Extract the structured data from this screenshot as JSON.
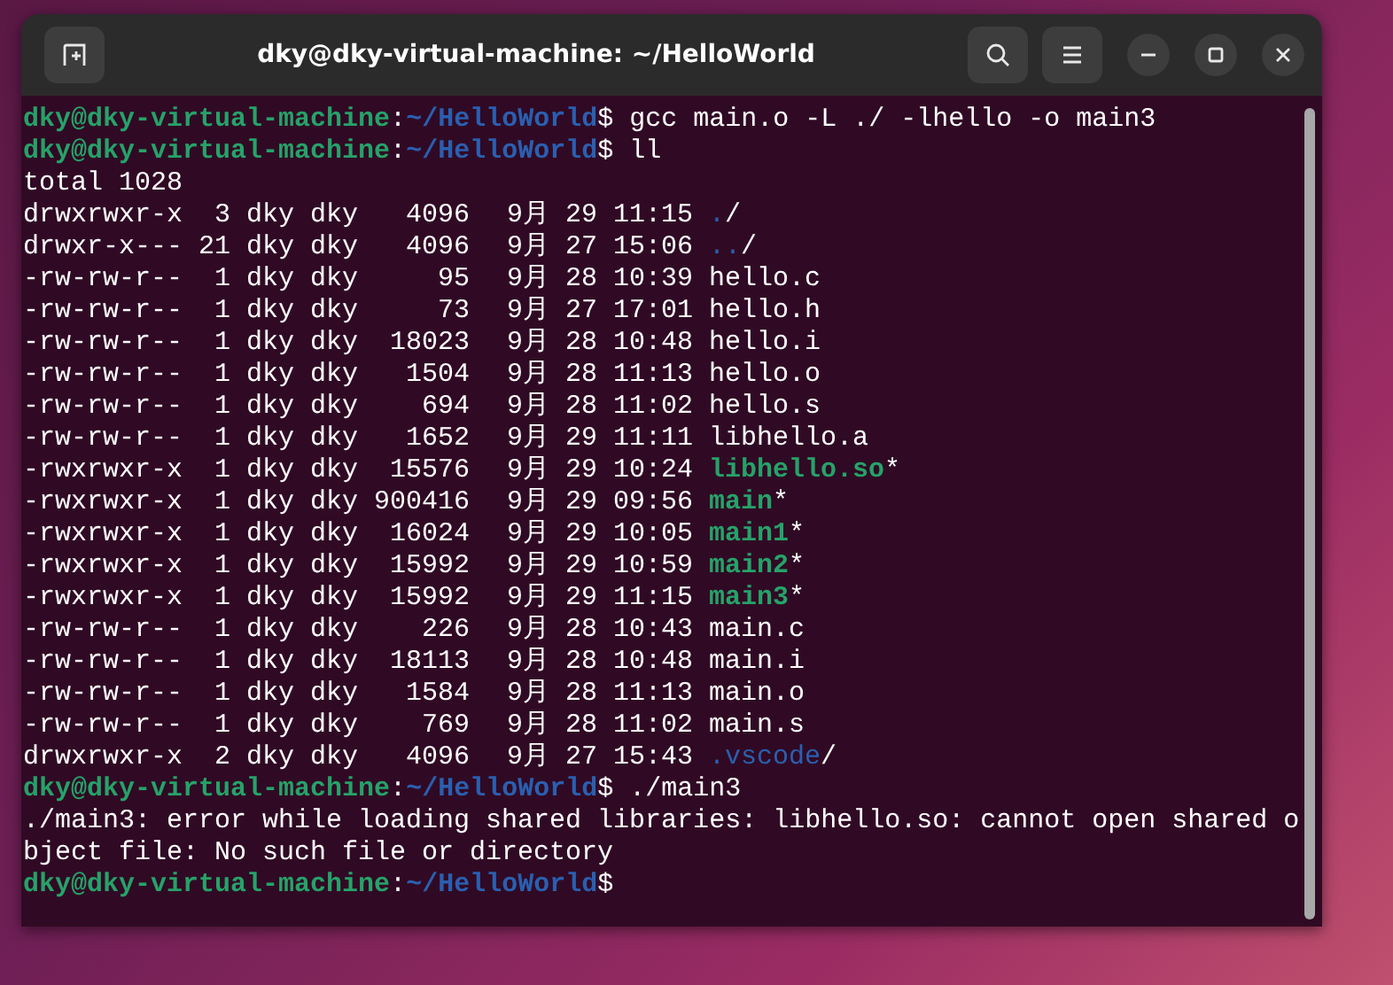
{
  "window": {
    "title": "dky@dky-virtual-machine: ~/HelloWorld"
  },
  "lines": [
    {
      "kind": "prompt",
      "user": "dky@dky-virtual-machine",
      "separator": ":",
      "path": "~/HelloWorld",
      "symbol": "$",
      "command": "gcc main.o -L ./ -lhello -o main3"
    },
    {
      "kind": "prompt",
      "user": "dky@dky-virtual-machine",
      "separator": ":",
      "path": "~/HelloWorld",
      "symbol": "$",
      "command": "ll"
    },
    {
      "kind": "output",
      "text": "total 1028"
    },
    {
      "kind": "entry",
      "perms": "drwxrwxr-x",
      "links": "3",
      "owner": "dky",
      "group": "dky",
      "size": "4096",
      "month": "9月",
      "day": "29",
      "time": "11:15",
      "file": {
        "name": ".",
        "kind": "dir",
        "suffix": "/"
      }
    },
    {
      "kind": "entry",
      "perms": "drwxr-x---",
      "links": "21",
      "owner": "dky",
      "group": "dky",
      "size": "4096",
      "month": "9月",
      "day": "27",
      "time": "15:06",
      "file": {
        "name": "..",
        "kind": "dir",
        "suffix": "/"
      }
    },
    {
      "kind": "entry",
      "perms": "-rw-rw-r--",
      "links": "1",
      "owner": "dky",
      "group": "dky",
      "size": "95",
      "month": "9月",
      "day": "28",
      "time": "10:39",
      "file": {
        "name": "hello.c",
        "kind": "file"
      }
    },
    {
      "kind": "entry",
      "perms": "-rw-rw-r--",
      "links": "1",
      "owner": "dky",
      "group": "dky",
      "size": "73",
      "month": "9月",
      "day": "27",
      "time": "17:01",
      "file": {
        "name": "hello.h",
        "kind": "file"
      }
    },
    {
      "kind": "entry",
      "perms": "-rw-rw-r--",
      "links": "1",
      "owner": "dky",
      "group": "dky",
      "size": "18023",
      "month": "9月",
      "day": "28",
      "time": "10:48",
      "file": {
        "name": "hello.i",
        "kind": "file"
      }
    },
    {
      "kind": "entry",
      "perms": "-rw-rw-r--",
      "links": "1",
      "owner": "dky",
      "group": "dky",
      "size": "1504",
      "month": "9月",
      "day": "28",
      "time": "11:13",
      "file": {
        "name": "hello.o",
        "kind": "file"
      }
    },
    {
      "kind": "entry",
      "perms": "-rw-rw-r--",
      "links": "1",
      "owner": "dky",
      "group": "dky",
      "size": "694",
      "month": "9月",
      "day": "28",
      "time": "11:02",
      "file": {
        "name": "hello.s",
        "kind": "file"
      }
    },
    {
      "kind": "entry",
      "perms": "-rw-rw-r--",
      "links": "1",
      "owner": "dky",
      "group": "dky",
      "size": "1652",
      "month": "9月",
      "day": "29",
      "time": "11:11",
      "file": {
        "name": "libhello.a",
        "kind": "file"
      }
    },
    {
      "kind": "entry",
      "perms": "-rwxrwxr-x",
      "links": "1",
      "owner": "dky",
      "group": "dky",
      "size": "15576",
      "month": "9月",
      "day": "29",
      "time": "10:24",
      "file": {
        "name": "libhello.so",
        "kind": "exec",
        "suffix": "*"
      }
    },
    {
      "kind": "entry",
      "perms": "-rwxrwxr-x",
      "links": "1",
      "owner": "dky",
      "group": "dky",
      "size": "900416",
      "month": "9月",
      "day": "29",
      "time": "09:56",
      "file": {
        "name": "main",
        "kind": "exec",
        "suffix": "*"
      }
    },
    {
      "kind": "entry",
      "perms": "-rwxrwxr-x",
      "links": "1",
      "owner": "dky",
      "group": "dky",
      "size": "16024",
      "month": "9月",
      "day": "29",
      "time": "10:05",
      "file": {
        "name": "main1",
        "kind": "exec",
        "suffix": "*"
      }
    },
    {
      "kind": "entry",
      "perms": "-rwxrwxr-x",
      "links": "1",
      "owner": "dky",
      "group": "dky",
      "size": "15992",
      "month": "9月",
      "day": "29",
      "time": "10:59",
      "file": {
        "name": "main2",
        "kind": "exec",
        "suffix": "*"
      }
    },
    {
      "kind": "entry",
      "perms": "-rwxrwxr-x",
      "links": "1",
      "owner": "dky",
      "group": "dky",
      "size": "15992",
      "month": "9月",
      "day": "29",
      "time": "11:15",
      "file": {
        "name": "main3",
        "kind": "exec",
        "suffix": "*"
      }
    },
    {
      "kind": "entry",
      "perms": "-rw-rw-r--",
      "links": "1",
      "owner": "dky",
      "group": "dky",
      "size": "226",
      "month": "9月",
      "day": "28",
      "time": "10:43",
      "file": {
        "name": "main.c",
        "kind": "file"
      }
    },
    {
      "kind": "entry",
      "perms": "-rw-rw-r--",
      "links": "1",
      "owner": "dky",
      "group": "dky",
      "size": "18113",
      "month": "9月",
      "day": "28",
      "time": "10:48",
      "file": {
        "name": "main.i",
        "kind": "file"
      }
    },
    {
      "kind": "entry",
      "perms": "-rw-rw-r--",
      "links": "1",
      "owner": "dky",
      "group": "dky",
      "size": "1584",
      "month": "9月",
      "day": "28",
      "time": "11:13",
      "file": {
        "name": "main.o",
        "kind": "file"
      }
    },
    {
      "kind": "entry",
      "perms": "-rw-rw-r--",
      "links": "1",
      "owner": "dky",
      "group": "dky",
      "size": "769",
      "month": "9月",
      "day": "28",
      "time": "11:02",
      "file": {
        "name": "main.s",
        "kind": "file"
      }
    },
    {
      "kind": "entry",
      "perms": "drwxrwxr-x",
      "links": "2",
      "owner": "dky",
      "group": "dky",
      "size": "4096",
      "month": "9月",
      "day": "27",
      "time": "15:43",
      "file": {
        "name": ".vscode",
        "kind": "dir",
        "suffix": "/"
      }
    },
    {
      "kind": "prompt",
      "user": "dky@dky-virtual-machine",
      "separator": ":",
      "path": "~/HelloWorld",
      "symbol": "$",
      "command": "./main3"
    },
    {
      "kind": "output",
      "text": "./main3: error while loading shared libraries: libhello.so: cannot open shared o"
    },
    {
      "kind": "output",
      "text": "bject file: No such file or directory"
    },
    {
      "kind": "prompt",
      "user": "dky@dky-virtual-machine",
      "separator": ":",
      "path": "~/HelloWorld",
      "symbol": "$"
    }
  ]
}
